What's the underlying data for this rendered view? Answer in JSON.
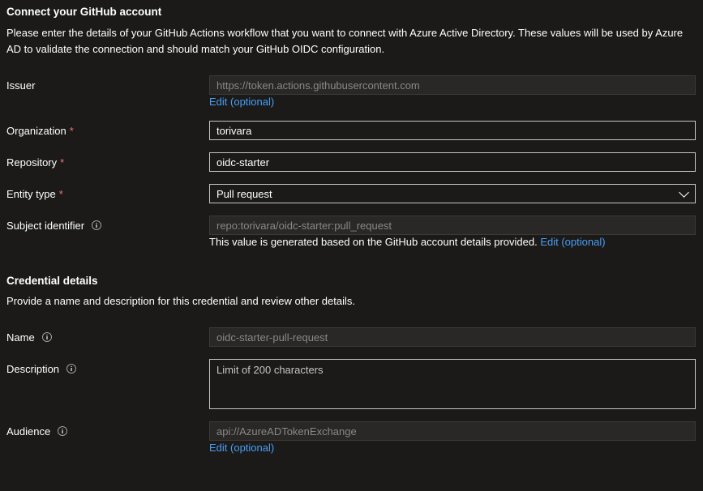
{
  "github_section": {
    "title": "Connect your GitHub account",
    "description": "Please enter the details of your GitHub Actions workflow that you want to connect with Azure Active Directory. These values will be used by Azure AD to validate the connection and should match your GitHub OIDC configuration."
  },
  "issuer": {
    "label": "Issuer",
    "placeholder": "https://token.actions.githubusercontent.com",
    "edit_link": "Edit (optional)"
  },
  "organization": {
    "label": "Organization",
    "required_mark": "*",
    "value": "torivara"
  },
  "repository": {
    "label": "Repository",
    "required_mark": "*",
    "value": "oidc-starter"
  },
  "entity_type": {
    "label": "Entity type",
    "required_mark": "*",
    "selected": "Pull request"
  },
  "subject_identifier": {
    "label": "Subject identifier",
    "value": "repo:torivara/oidc-starter:pull_request",
    "helper_text": "This value is generated based on the GitHub account details provided.",
    "edit_link": "Edit (optional)"
  },
  "credential_section": {
    "title": "Credential details",
    "description": "Provide a name and description for this credential and review other details."
  },
  "name": {
    "label": "Name",
    "value": "oidc-starter-pull-request"
  },
  "description": {
    "label": "Description",
    "placeholder": "Limit of 200 characters"
  },
  "audience": {
    "label": "Audience",
    "value": "api://AzureADTokenExchange",
    "edit_link": "Edit (optional)"
  },
  "icons": {
    "info": "info-icon",
    "dropdown": "chevron-down-icon"
  },
  "colors": {
    "background": "#1b1a19",
    "link": "#479ef5",
    "required": "#f1707b"
  }
}
